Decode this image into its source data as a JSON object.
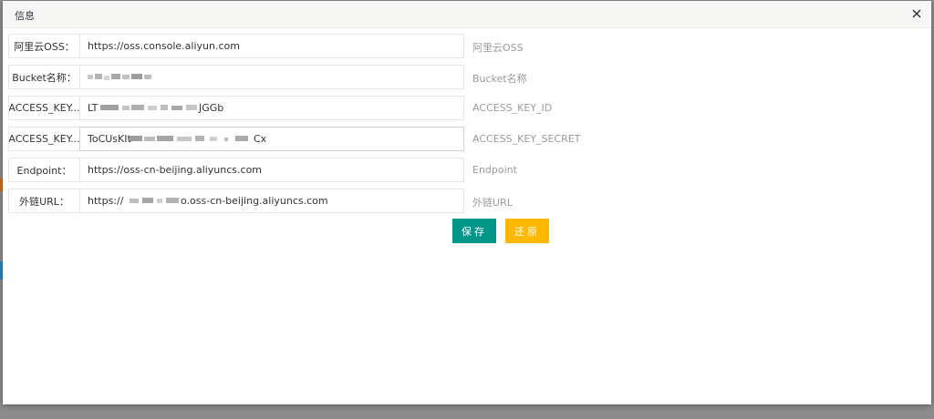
{
  "dialog": {
    "title": "信息"
  },
  "fields": [
    {
      "label": "阿里云OSS：",
      "value": "https://oss.console.aliyun.com",
      "hint": "阿里云OSS"
    },
    {
      "label": "Bucket名称：",
      "value": "",
      "hint": "Bucket名称"
    },
    {
      "label": "ACCESS_KEY...",
      "value": "LT",
      "value_tail": "JGGb",
      "hint": "ACCESS_KEY_ID"
    },
    {
      "label": "ACCESS_KEY...",
      "value": "ToCUsKIt",
      "value_tail": "Cx",
      "hint": "ACCESS_KEY_SECRET"
    },
    {
      "label": "Endpoint：",
      "value": "https://oss-cn-beijing.aliyuncs.com",
      "hint": "Endpoint"
    },
    {
      "label": "外链URL：",
      "value": "https://",
      "value_tail": "o.oss-cn-beijing.aliyuncs.com",
      "hint": "外链URL"
    }
  ],
  "actions": {
    "save_label": "保存",
    "reset_label": "还原"
  },
  "colors": {
    "save": "#009688",
    "reset": "#ffb800",
    "header_bg": "#f7f8f6",
    "overlay": "#8c8c8c"
  },
  "icons": {
    "close": "close-icon"
  }
}
